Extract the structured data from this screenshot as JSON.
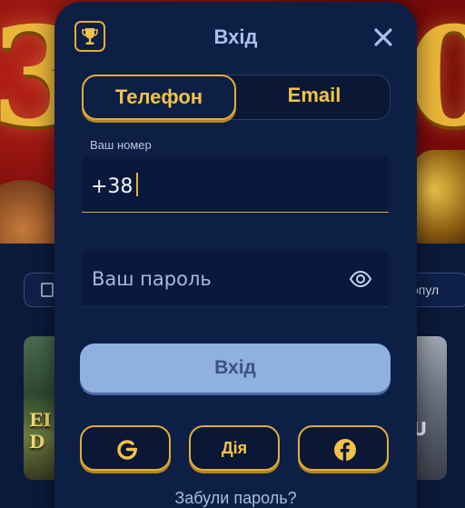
{
  "background": {
    "banner_left_text": "3",
    "banner_right_text": "0",
    "right_chip_label": "опул",
    "left_card_text": "EI D",
    "right_card_text": "U"
  },
  "modal": {
    "title": "Вхід",
    "tabs": [
      {
        "label": "Телефон",
        "active": true
      },
      {
        "label": "Email",
        "active": false
      }
    ],
    "phone": {
      "label": "Ваш номер",
      "value": "+38"
    },
    "password": {
      "placeholder": "Ваш пароль"
    },
    "submit_label": "Вхід",
    "social": {
      "diia_label": "Дія"
    },
    "forgot_password": "Забули пароль?"
  },
  "colors": {
    "modal_bg": "#0d1f45",
    "accent_gold": "#e2ae36",
    "submit_bg": "#8fb0e0"
  },
  "icons": [
    "trophy-icon",
    "close-icon",
    "eye-icon",
    "google-icon",
    "facebook-icon",
    "grid-icon"
  ]
}
